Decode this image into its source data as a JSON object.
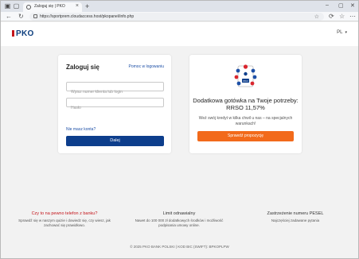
{
  "browser": {
    "tab_title": "Zaloguj się | PKO",
    "new_tab": "+",
    "url": "https://sportprem.cloudaccess.host/pkopanel/info.php"
  },
  "header": {
    "logo_text": "PKO",
    "language": "PL"
  },
  "login": {
    "title": "Zaloguj się",
    "help_link": "Pomoc w logowaniu",
    "client_placeholder": "Wpisz numer klienta lub login",
    "password_placeholder": "Hasło",
    "no_account": "Nie masz konta?",
    "next_button": "Dalej"
  },
  "promo": {
    "headline": "Dodatkowa gotówka na Twoje potrzeby: RRSO 11,57%",
    "description": "Weź swój kredyt w kilka chwil u nas – na specjalnych warunkach!",
    "button": "Sprawdź propozycję",
    "illustration_label": "PKO"
  },
  "footer": {
    "columns": [
      {
        "title": "Czy to na pewno telefon z banku?",
        "text": "Sprawdź się w naszym quizie i dowiedz się, czy wiesz, jak zachować się prawidłowo."
      },
      {
        "title": "Limit odnawialny",
        "text": "Nawet do 100 000 zł dodatkowych środków i możliwość podpisania umowy online."
      },
      {
        "title": "Zastrzeżenie numeru PESEL",
        "text": "Najczęściej zadawane pytania"
      }
    ],
    "copyright": "© 2025 PKO BANK POLSKI | KOD BIC (SWIFT): BPKOPLPW"
  },
  "colors": {
    "brand_navy": "#0d3e8c",
    "brand_red": "#c4161c",
    "cta_orange": "#f26a1b",
    "link_blue": "#1d4fa6"
  }
}
